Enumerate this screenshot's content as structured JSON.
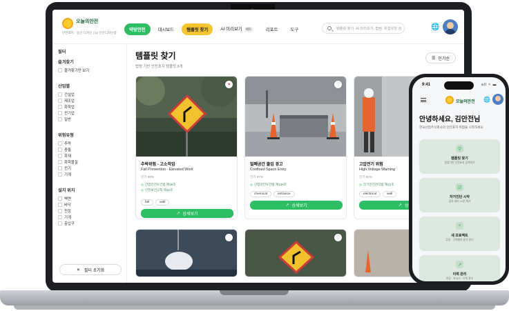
{
  "header": {
    "logo_name": "오늘의안전",
    "logo_sub": "안전표지 · 동선 디자인 | by 안전디자인랩",
    "nav": [
      "약맞안전",
      "대시보드",
      "템플릿 찾기",
      "AI 미리보기",
      "리포트",
      "도구"
    ],
    "beta": "베타",
    "search_placeholder": "템플릿 찾기, AI 미리보기, 법령, 위험유형 검"
  },
  "sidebar": {
    "filter_title": "필터",
    "favorites_title": "즐겨찾기",
    "favorites_item": "즐겨찾기만 보기",
    "industry_title": "산업별",
    "industries": [
      "건설업",
      "제조업",
      "화학업",
      "전기업",
      "일반"
    ],
    "risk_title": "위험유형",
    "risks": [
      "추락",
      "충돌",
      "화재",
      "화학물질",
      "전기",
      "기계"
    ],
    "location_title": "설치 위치",
    "locations": [
      "벽면",
      "바닥",
      "천장",
      "기계",
      "출입구"
    ],
    "reset_label": "필터 초기화",
    "reset_icon": "close-icon"
  },
  "main": {
    "title": "템플릿 찾기",
    "subtitle": "법령 기반 안전표지 템플릿 8개",
    "sort_label": "인기순"
  },
  "cards": [
    {
      "title": "추락위험 - 고소작업",
      "english": "Fall Prevention - Elevated Work",
      "popularity": "인기 98%",
      "laws": [
        "산업안전보건법 제38조",
        "안전보건규칙 제42조"
      ],
      "tags": [
        "fall",
        "wall"
      ],
      "button": "상세보기",
      "liked": true
    },
    {
      "title": "밀폐공간 출입 경고",
      "english": "Confined Space Entry",
      "popularity": "인기 87%",
      "laws": [
        "산업안전보건법 제138조"
      ],
      "tags": [
        "chemical",
        "entrance"
      ],
      "button": "상세보기",
      "liked": false
    },
    {
      "title": "고압전기 위험",
      "english": "High Voltage Warning",
      "popularity": "인기 92%",
      "laws": [
        "전기안전관리법 제22조"
      ],
      "tags": [
        "electrical",
        "wall"
      ],
      "button": "상세",
      "liked": false
    }
  ],
  "phone": {
    "time": "9:41",
    "status": "all ≈ ▬",
    "logo_name": "오늘의안전",
    "greeting": "안녕하세요, 김안전님",
    "description": "한국산업주식회사의 안전표지 위험을 시작하세요",
    "actions": [
      {
        "title": "템플릿 찾기",
        "sub": "법령기반 안전표지 검색하기",
        "icon": "search-icon"
      },
      {
        "title": "자가진단 시작",
        "sub": "검사 대비 12문 체크",
        "icon": "checklist-icon"
      },
      {
        "title": "새 프로젝트",
        "sub": "공정 · 구역별로 분석 관리",
        "icon": "plus-icon"
      },
      {
        "title": "이력 관리",
        "sub": "현장 · 보고서 · 이력 관리",
        "icon": "chart-icon"
      }
    ]
  },
  "colors": {
    "primary": "#2dbd63",
    "accent": "#f6c52f",
    "brand_text": "#1d6b3a"
  }
}
